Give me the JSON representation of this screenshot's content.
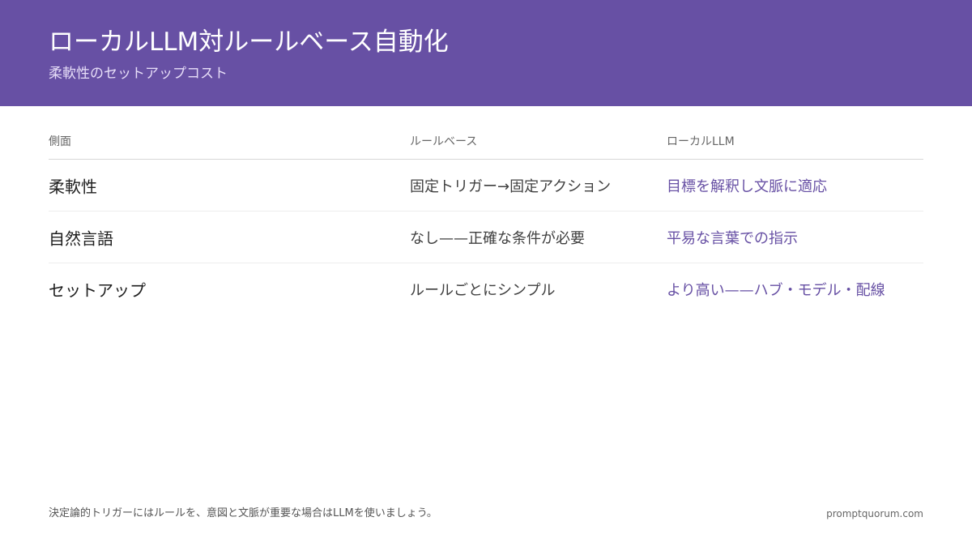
{
  "header": {
    "title": "ローカルLLM対ルールベース自動化",
    "subtitle": "柔軟性のセットアップコスト"
  },
  "table": {
    "columns": [
      "側面",
      "ルールベース",
      "ローカルLLM"
    ],
    "rows": [
      [
        "柔軟性",
        "固定トリガー→固定アクション",
        "目標を解釈し文脈に適応"
      ],
      [
        "自然言語",
        "なし——正確な条件が必要",
        "平易な言葉での指示"
      ],
      [
        "セットアップ",
        "ルールごとにシンプル",
        "より高い——ハブ・モデル・配線"
      ]
    ]
  },
  "footer": {
    "note": "決定論的トリガーにはルールを、意図と文脈が重要な場合はLLMを使いましょう。",
    "brand": "promptquorum.com"
  },
  "colors": {
    "header_bg": "#6750a4",
    "accent_text": "#6750a4"
  }
}
